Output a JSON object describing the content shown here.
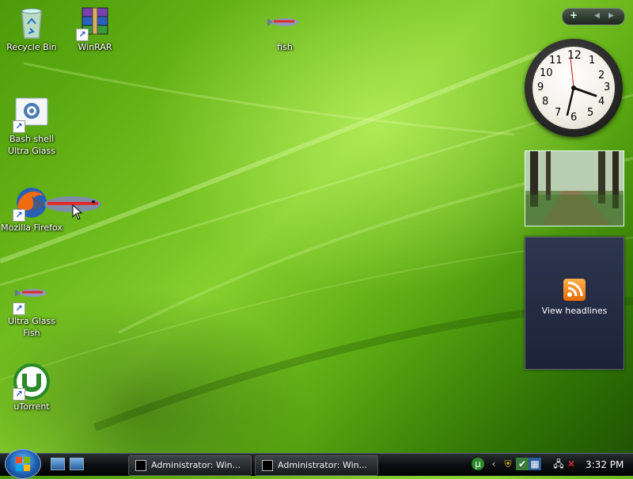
{
  "desktop": {
    "icons": [
      {
        "label": "Recycle Bin"
      },
      {
        "label": "WinRAR"
      },
      {
        "label": "fish"
      },
      {
        "label": "Bash shell Ultra Glass"
      },
      {
        "label": "Mozilla Firefox"
      },
      {
        "label": "Ultra Glass Fish"
      },
      {
        "label": "uTorrent"
      }
    ]
  },
  "sidebar": {
    "add_symbol": "+",
    "prev_symbol": "◀",
    "next_symbol": "▶",
    "clock": {
      "numerals": [
        "12",
        "1",
        "2",
        "3",
        "4",
        "5",
        "6",
        "7",
        "8",
        "9",
        "10",
        "11"
      ]
    },
    "feed": {
      "label": "View headlines"
    }
  },
  "taskbar": {
    "tasks": [
      {
        "label": "Administrator:  Win..."
      },
      {
        "label": "Administrator:  Win..."
      }
    ],
    "clock": "3:32 PM"
  }
}
